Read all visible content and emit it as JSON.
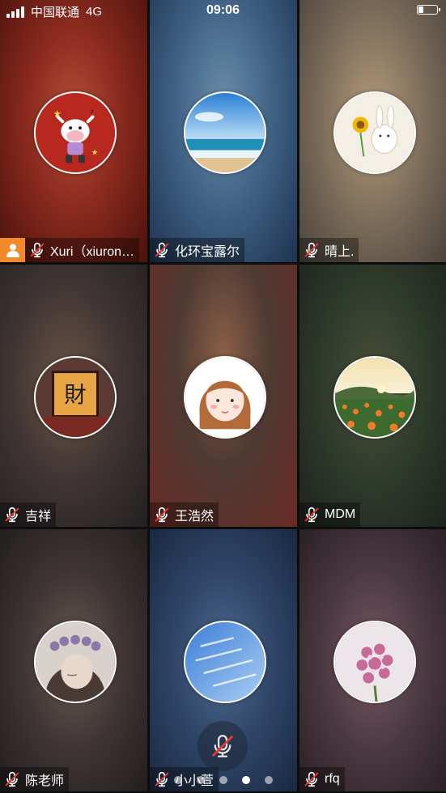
{
  "status_bar": {
    "carrier": "中国联通",
    "network": "4G",
    "time": "09:06",
    "battery_level": 0.3
  },
  "participants": [
    {
      "name": "Xuri（xiuron…",
      "muted": true,
      "host": true,
      "avatar": "cartoon-cow-avatar",
      "bg": [
        "#6e1d14",
        "#c75a40"
      ]
    },
    {
      "name": "化环宝露尔",
      "muted": true,
      "host": false,
      "avatar": "beach-photo-avatar",
      "bg": [
        "#2a4363",
        "#6b8eaa"
      ]
    },
    {
      "name": "晴上.",
      "muted": true,
      "host": false,
      "avatar": "bunny-sunflower-avatar",
      "bg": [
        "#5a5248",
        "#a89478"
      ]
    },
    {
      "name": "吉祥",
      "muted": true,
      "host": false,
      "avatar": "calligraphy-sign-avatar",
      "bg": [
        "#2e2b2b",
        "#6e5a4a"
      ]
    },
    {
      "name": "王浩然",
      "muted": true,
      "host": false,
      "avatar": "cartoon-girl-avatar",
      "bg": [
        "#3e2a22",
        "#8c5240"
      ]
    },
    {
      "name": "MDM",
      "muted": true,
      "host": false,
      "avatar": "flower-field-avatar",
      "bg": [
        "#3a3c32",
        "#2a4a2c"
      ]
    },
    {
      "name": "陈老师",
      "muted": true,
      "host": false,
      "avatar": "woman-flower-crown-avatar",
      "bg": [
        "#2e2a2a",
        "#5e4e46"
      ]
    },
    {
      "name": "小小萱",
      "muted": true,
      "host": false,
      "avatar": "blue-sky-avatar",
      "bg": [
        "#223656",
        "#4a6486"
      ]
    },
    {
      "name": "rfq",
      "muted": true,
      "host": false,
      "avatar": "lilac-flowers-avatar",
      "bg": [
        "#3e3034",
        "#7a5a66"
      ]
    }
  ],
  "controls": {
    "mic": "muted-microphone-icon",
    "host_icon": "host-person-icon"
  },
  "pagination": {
    "pages": 5,
    "current": 4
  }
}
